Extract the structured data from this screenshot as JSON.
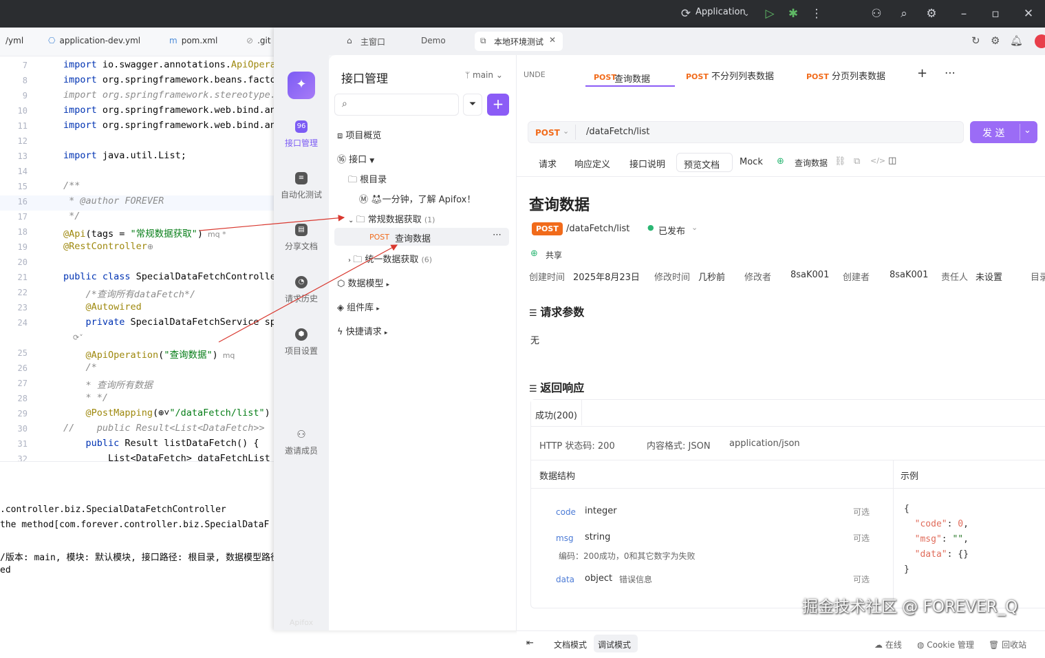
{
  "ide": {
    "run_config": "Application",
    "tabs": [
      "/yml",
      "application-dev.yml",
      "pom.xml",
      ".git"
    ],
    "code_lines": [
      {
        "n": "7",
        "segs": [
          [
            "kw",
            "import "
          ],
          [
            "",
            "io.swagger.annotations."
          ],
          [
            "ann",
            "ApiOpera"
          ]
        ]
      },
      {
        "n": "8",
        "segs": [
          [
            "kw",
            "import "
          ],
          [
            "",
            "org.springframework.beans.facto"
          ]
        ]
      },
      {
        "n": "9",
        "segs": [
          [
            "cm",
            "import org.springframework.stereotype."
          ]
        ]
      },
      {
        "n": "10",
        "segs": [
          [
            "kw",
            "import "
          ],
          [
            "",
            "org.springframework.web.bind.an"
          ]
        ]
      },
      {
        "n": "11",
        "segs": [
          [
            "kw",
            "import "
          ],
          [
            "",
            "org.springframework.web.bind.an"
          ]
        ]
      },
      {
        "n": "12",
        "segs": []
      },
      {
        "n": "13",
        "segs": [
          [
            "kw",
            "import "
          ],
          [
            "",
            "java.util.List;"
          ]
        ]
      },
      {
        "n": "14",
        "segs": []
      },
      {
        "n": "15",
        "segs": [
          [
            "cm",
            "/**"
          ]
        ]
      },
      {
        "n": "16",
        "segs": [
          [
            "cm",
            " * @author FOREVER"
          ]
        ]
      },
      {
        "n": "17",
        "segs": [
          [
            "cm",
            " */"
          ]
        ]
      },
      {
        "n": "18",
        "segs": [
          [
            "ann",
            "@Api"
          ],
          [
            "",
            "(tags = "
          ],
          [
            "str",
            "\"常规数据获取\""
          ],
          [
            "",
            ")"
          ],
          [
            "hint",
            "  mq *"
          ]
        ]
      },
      {
        "n": "19",
        "segs": [
          [
            "ann",
            "@RestController"
          ],
          [
            "hint",
            "⊕"
          ]
        ]
      },
      {
        "n": "20",
        "segs": []
      },
      {
        "n": "21",
        "segs": [
          [
            "kw",
            "public class "
          ],
          [
            "",
            "SpecialDataFetchControlle"
          ]
        ]
      },
      {
        "n": "22",
        "segs": [
          [
            "cm",
            "    /*查询所有dataFetch*/"
          ]
        ]
      },
      {
        "n": "23",
        "segs": [
          [
            "ann",
            "    @Autowired"
          ]
        ]
      },
      {
        "n": "24",
        "segs": [
          [
            "kw",
            "    private "
          ],
          [
            "",
            "SpecialDataFetchService sp"
          ]
        ]
      },
      {
        "n": "",
        "segs": [
          [
            "hint",
            "    ⟳˅"
          ]
        ]
      },
      {
        "n": "25",
        "segs": [
          [
            "ann",
            "    @ApiOperation"
          ],
          [
            "",
            "("
          ],
          [
            "str",
            "\"查询数据\""
          ],
          [
            "",
            ")"
          ],
          [
            "hint",
            "  mq"
          ]
        ]
      },
      {
        "n": "26",
        "segs": [
          [
            "cm",
            "    /*"
          ]
        ]
      },
      {
        "n": "27",
        "segs": [
          [
            "cm",
            "    * 查询所有数据"
          ]
        ]
      },
      {
        "n": "28",
        "segs": [
          [
            "cm",
            "    * */"
          ]
        ]
      },
      {
        "n": "29",
        "segs": [
          [
            "ann",
            "    @PostMapping"
          ],
          [
            "",
            "(⊕˅"
          ],
          [
            "str",
            "\"/dataFetch/list\""
          ],
          [
            "",
            ")"
          ]
        ]
      },
      {
        "n": "30",
        "segs": [
          [
            "cm",
            "//    public Result<List<DataFetch>>"
          ]
        ]
      },
      {
        "n": "31",
        "segs": [
          [
            "kw",
            "    public "
          ],
          [
            "",
            "Result listDataFetch() {"
          ]
        ]
      },
      {
        "n": "32",
        "segs": [
          [
            "",
            "        List<DataFetch> dataFetchList"
          ]
        ]
      }
    ],
    "console_lines": [
      ".controller.biz.SpecialDataFetchController",
      "the method[com.forever.controller.biz.SpecialDataF",
      "",
      "/版本: main, 模块: 默认模块, 接口路径: 根目录, 数据模型路径",
      "ed"
    ]
  },
  "apifox": {
    "tabs": [
      "主窗口",
      "Demo",
      "本地环境测试"
    ],
    "rail": [
      "接口管理",
      "自动化测试",
      "分享文档",
      "请求历史",
      "项目设置",
      "邀请成员",
      "Apifox"
    ],
    "tree": {
      "title": "接口管理",
      "branch": "main",
      "items": [
        "项目概览",
        "接口",
        "根目录",
        "一分钟，了解 Apifox！",
        "常规数据获取",
        "(1)",
        "查询数据",
        "统一数据获取",
        "(6)",
        "数据模型",
        "组件库",
        "快捷请求"
      ],
      "post_label": "POST"
    },
    "doc_tabs": {
      "unde": "UNDE",
      "t1": "查询数据",
      "t2": "不分列列表数据",
      "t3": "分页列表数据",
      "post": "POST"
    },
    "request": {
      "method": "POST",
      "url": "/dataFetch/list",
      "send": "发 送"
    },
    "subtabs": [
      "请求",
      "响应定义",
      "接口说明",
      "预览文档",
      "Mock",
      "查询数据"
    ],
    "doc": {
      "title": "查询数据",
      "path": "/dataFetch/list",
      "status": "已发布",
      "share": "共享",
      "meta": [
        "创建时间",
        "2025年8月23日",
        "修改时间",
        "几秒前",
        "修改者",
        "8saK001",
        "创建者",
        "8saK001",
        "责任人",
        "未设置",
        "目录"
      ],
      "req_params": "请求参数",
      "none": "无",
      "response": "返回响应",
      "success": "成功(200)",
      "http": "HTTP 状态码: 200",
      "format": "内容格式: JSON",
      "mime": "application/json",
      "schema": "数据结构",
      "example": "示例",
      "fields": [
        {
          "name": "code",
          "type": "integer",
          "opt": "可选",
          "desc": ""
        },
        {
          "name": "msg",
          "type": "string",
          "opt": "可选",
          "desc": "编码：200成功，0和其它数字为失败"
        },
        {
          "name": "data",
          "type": "object",
          "opt": "可选",
          "desc": "错误信息"
        }
      ]
    },
    "footer": {
      "doc_mode": "文档模式",
      "debug_mode": "调试模式",
      "online": "在线",
      "cookie": "Cookie 管理",
      "recycle": "回收站",
      "watermark": "掘金技术社区 @ FOREVER_Q"
    }
  }
}
